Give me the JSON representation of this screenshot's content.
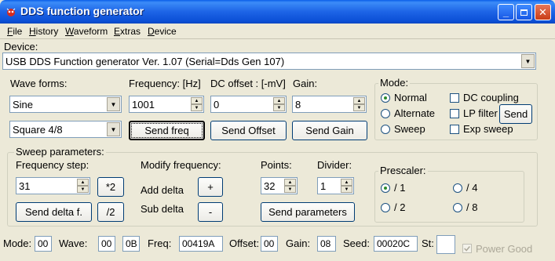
{
  "window": {
    "title": "DDS function generator"
  },
  "menu": [
    {
      "first": "F",
      "rest": "ile"
    },
    {
      "first": "H",
      "rest": "istory"
    },
    {
      "first": "W",
      "rest": "aveform"
    },
    {
      "first": "E",
      "rest": "xtras"
    },
    {
      "first": "D",
      "rest": "evice"
    }
  ],
  "device": {
    "label": "Device:",
    "selected": "USB DDS Function generator Ver. 1.07 (Serial=Dds Gen 107)"
  },
  "waveforms": {
    "label": "Wave forms:",
    "primary": "Sine",
    "secondary": "Square 4/8"
  },
  "frequency": {
    "label": "Frequency: [Hz]",
    "value": "1001",
    "send_label": "Send freq"
  },
  "offset": {
    "label": "DC offset : [-mV]",
    "value": "0",
    "send_label": "Send Offset"
  },
  "gain": {
    "label": "Gain:",
    "value": "8",
    "send_label": "Send Gain"
  },
  "mode": {
    "title": "Mode:",
    "radios": {
      "normal": "Normal",
      "alternate": "Alternate",
      "sweep": "Sweep"
    },
    "checks": {
      "dc": "DC coupling",
      "lp": "LP filter",
      "exp": "Exp sweep"
    },
    "send_label": "Send"
  },
  "sweep": {
    "title": "Sweep parameters:",
    "freq_step_label": "Frequency step:",
    "freq_step_value": "31",
    "times2_label": "*2",
    "div2_label": "/2",
    "send_delta_label": "Send delta f.",
    "modify_label": "Modify frequency:",
    "add_delta_label": "Add delta",
    "sub_delta_label": "Sub delta",
    "plus_label": "+",
    "minus_label": "-",
    "points_label": "Points:",
    "points_value": "32",
    "divider_label": "Divider:",
    "divider_value": "1",
    "send_params_label": "Send parameters"
  },
  "prescaler": {
    "title": "Prescaler:",
    "options": {
      "p1": "/ 1",
      "p2": "/ 2",
      "p4": "/ 4",
      "p8": "/ 8"
    }
  },
  "status": {
    "mode_label": "Mode:",
    "mode_value": "00",
    "wave_label": "Wave:",
    "wave_value1": "00",
    "wave_value2": "0B",
    "freq_label": "Freq:",
    "freq_value": "00419A",
    "offset_label": "Offset:",
    "offset_value": "00",
    "gain_label": "Gain:",
    "gain_value": "08",
    "seed_label": "Seed:",
    "seed_value": "00020C",
    "st_label": "St:",
    "st_value": "",
    "power_good_label": "Power Good"
  },
  "colors": {
    "titlebar": "#0b4fd6",
    "face": "#ece9d8",
    "radio_dot": "#2c8a2c"
  }
}
